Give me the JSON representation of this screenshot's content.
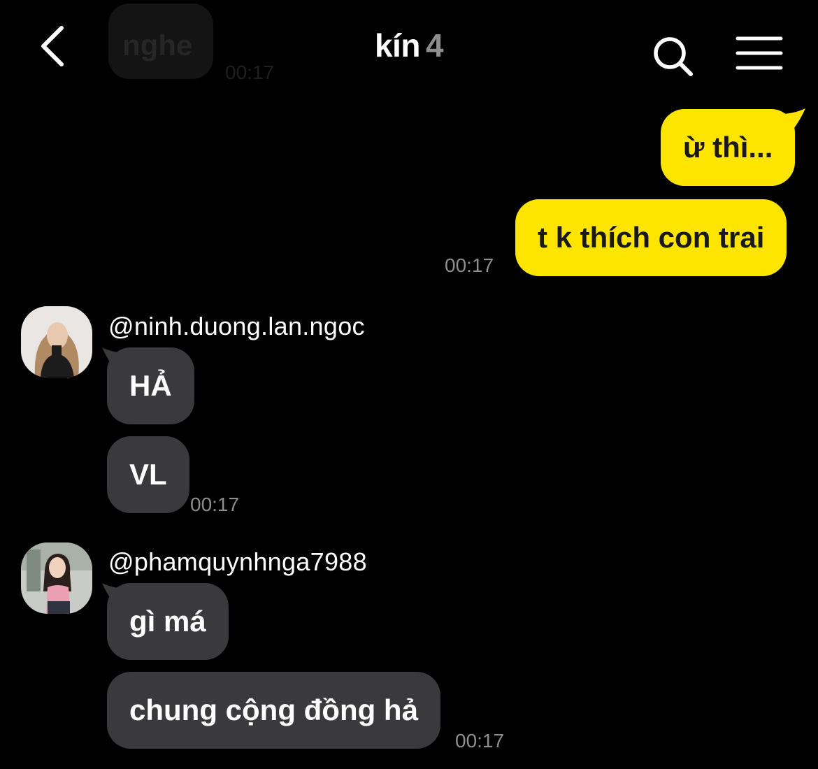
{
  "header": {
    "title": "kín",
    "member_count": "4"
  },
  "ghost": {
    "text": "nghe",
    "time": "00:17"
  },
  "messages": {
    "me": {
      "bubbles": [
        "ừ thì...",
        "t k thích con trai"
      ],
      "time": "00:17"
    },
    "group1": {
      "sender": "@ninh.duong.lan.ngoc",
      "bubbles": [
        "HẢ",
        "VL"
      ],
      "time": "00:17"
    },
    "group2": {
      "sender": "@phamquynhnga7988",
      "bubbles": [
        "gì má",
        "chung cộng đồng hả"
      ],
      "time": "00:17"
    }
  },
  "colors": {
    "background": "#000000",
    "my_bubble": "#fee500",
    "other_bubble": "#3a3a3c",
    "timestamp": "#8e8e8e"
  }
}
